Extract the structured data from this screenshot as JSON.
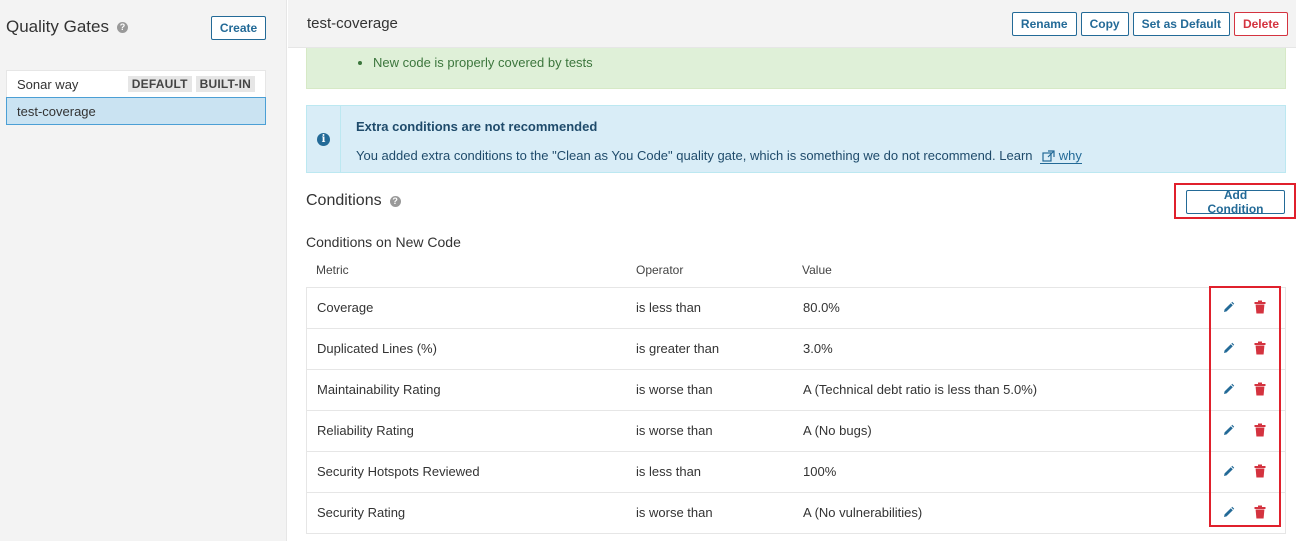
{
  "sidebar": {
    "title": "Quality Gates",
    "help_glyph": "?",
    "create_label": "Create",
    "gates": [
      {
        "name": "Sonar way",
        "badges": [
          "DEFAULT",
          "BUILT-IN"
        ]
      },
      {
        "name": "test-coverage",
        "badges": [],
        "selected": true
      }
    ]
  },
  "header": {
    "title": "test-coverage",
    "actions": {
      "rename": "Rename",
      "copy": "Copy",
      "set_default": "Set as Default",
      "delete": "Delete"
    }
  },
  "success": {
    "item": "New code is properly covered by tests"
  },
  "info": {
    "icon_glyph": "i",
    "title": "Extra conditions are not recommended",
    "text": "You added extra conditions to the \"Clean as You Code\" quality gate, which is something we do not recommend. Learn",
    "link": "why"
  },
  "conditions": {
    "title": "Conditions",
    "help_glyph": "?",
    "add_label": "Add Condition",
    "subtitle": "Conditions on New Code",
    "columns": {
      "metric": "Metric",
      "operator": "Operator",
      "value": "Value"
    },
    "rows": [
      {
        "metric": "Coverage",
        "operator": "is less than",
        "value": "80.0%"
      },
      {
        "metric": "Duplicated Lines (%)",
        "operator": "is greater than",
        "value": "3.0%"
      },
      {
        "metric": "Maintainability Rating",
        "operator": "is worse than",
        "value": "A  (Technical debt ratio is less than 5.0%)"
      },
      {
        "metric": "Reliability Rating",
        "operator": "is worse than",
        "value": "A  (No bugs)"
      },
      {
        "metric": "Security Hotspots Reviewed",
        "operator": "is less than",
        "value": "100%"
      },
      {
        "metric": "Security Rating",
        "operator": "is worse than",
        "value": "A  (No vulnerabilities)"
      }
    ]
  },
  "colors": {
    "accent": "#236a97",
    "danger": "#d4333f",
    "highlight": "#e0202c"
  }
}
